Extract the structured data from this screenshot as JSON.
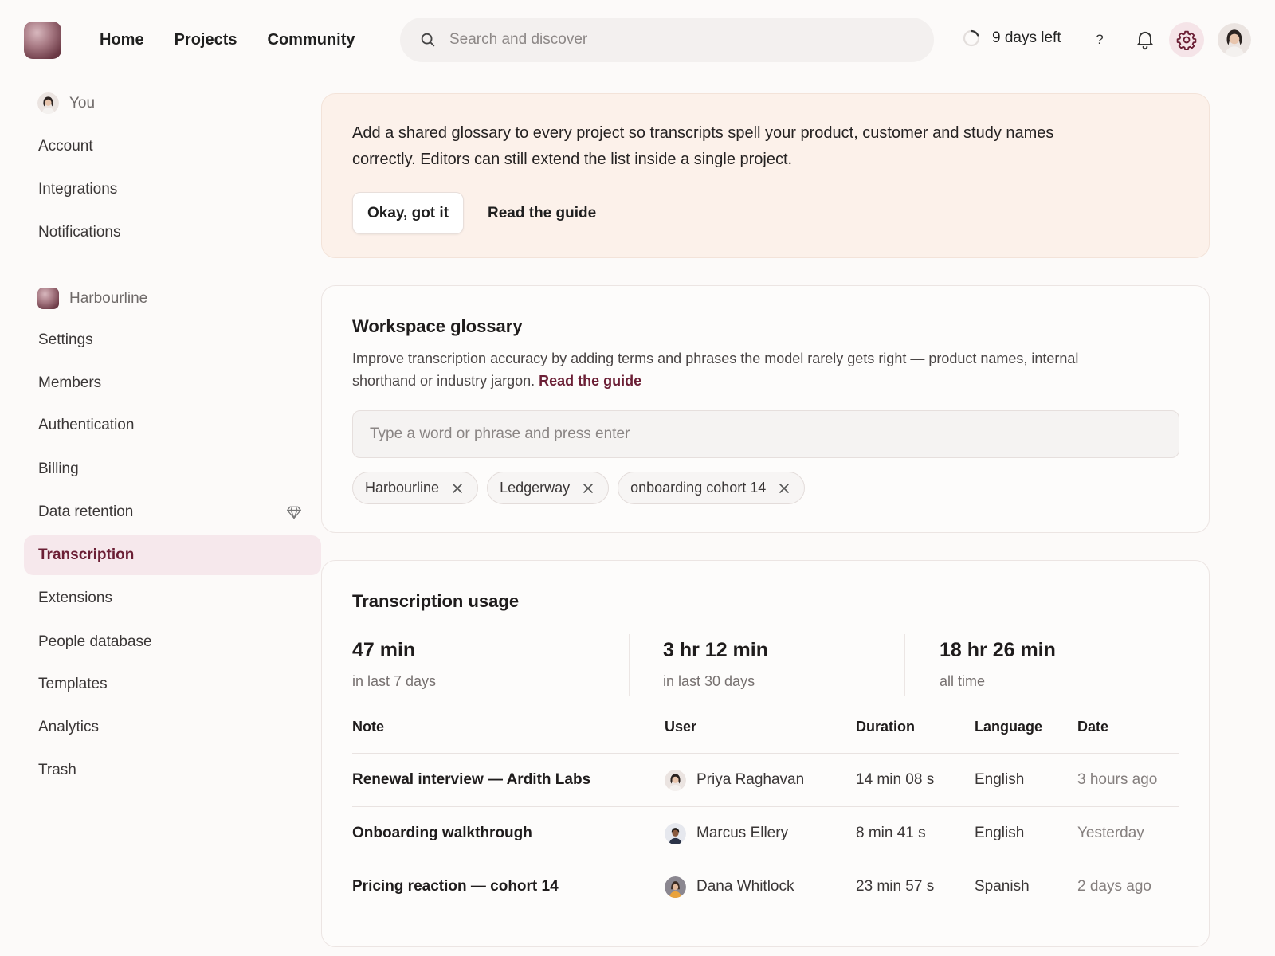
{
  "nav": {
    "items": [
      "Home",
      "Projects",
      "Community"
    ]
  },
  "search": {
    "placeholder": "Search and discover"
  },
  "trial": {
    "label": "9 days left"
  },
  "help": {
    "label": "?"
  },
  "sidebar": {
    "personal": {
      "header": "You",
      "items": [
        "Account",
        "Integrations",
        "Notifications"
      ]
    },
    "workspace": {
      "header": "Harbourline",
      "items": [
        "Settings",
        "Members",
        "Authentication",
        "Billing",
        "Data retention",
        "Transcription",
        "Extensions",
        "People database",
        "Templates",
        "Analytics",
        "Trash"
      ],
      "active": "Transcription",
      "premium_item": "Data retention"
    }
  },
  "banner": {
    "text": "Add a shared glossary to every project so transcripts spell your product, customer and study names correctly. Editors can still extend the list inside a single project.",
    "primary_label": "Okay, got it",
    "secondary_label": "Read the guide"
  },
  "glossary": {
    "title": "Workspace glossary",
    "description": "Improve transcription accuracy by adding terms and phrases the model rarely gets right — product names, internal shorthand or industry jargon.",
    "link_label": "Read the guide",
    "input_placeholder": "Type a word or phrase and press enter",
    "tags": [
      "Harbourline",
      "Ledgerway",
      "onboarding cohort 14"
    ]
  },
  "usage": {
    "title": "Transcription usage",
    "stats": [
      {
        "value": "47 min",
        "label": "in last 7 days"
      },
      {
        "value": "3 hr 12 min",
        "label": "in last 30 days"
      },
      {
        "value": "18 hr 26 min",
        "label": "all time"
      }
    ],
    "columns": [
      "Note",
      "User",
      "Duration",
      "Language",
      "Date"
    ],
    "rows": [
      {
        "note": "Renewal interview — Ardith Labs",
        "user": "Priya Raghavan",
        "duration": "14 min 08 s",
        "language": "English",
        "date": "3 hours ago"
      },
      {
        "note": "Onboarding walkthrough",
        "user": "Marcus Ellery",
        "duration": "8 min 41 s",
        "language": "English",
        "date": "Yesterday"
      },
      {
        "note": "Pricing reaction — cohort 14",
        "user": "Dana Whitlock",
        "duration": "23 min 57 s",
        "language": "Spanish",
        "date": "2 days ago"
      }
    ]
  },
  "colors": {
    "accent": "#6b1f35",
    "active_bg": "#f6e8ec",
    "banner_bg": "#fcf1ea",
    "page_bg": "#fcfaf9"
  },
  "icons": {
    "search": "search-icon",
    "trial": "loading-ring-icon",
    "bell": "bell-icon",
    "settings": "gear-icon",
    "premium": "diamond-icon",
    "remove": "close-icon"
  }
}
